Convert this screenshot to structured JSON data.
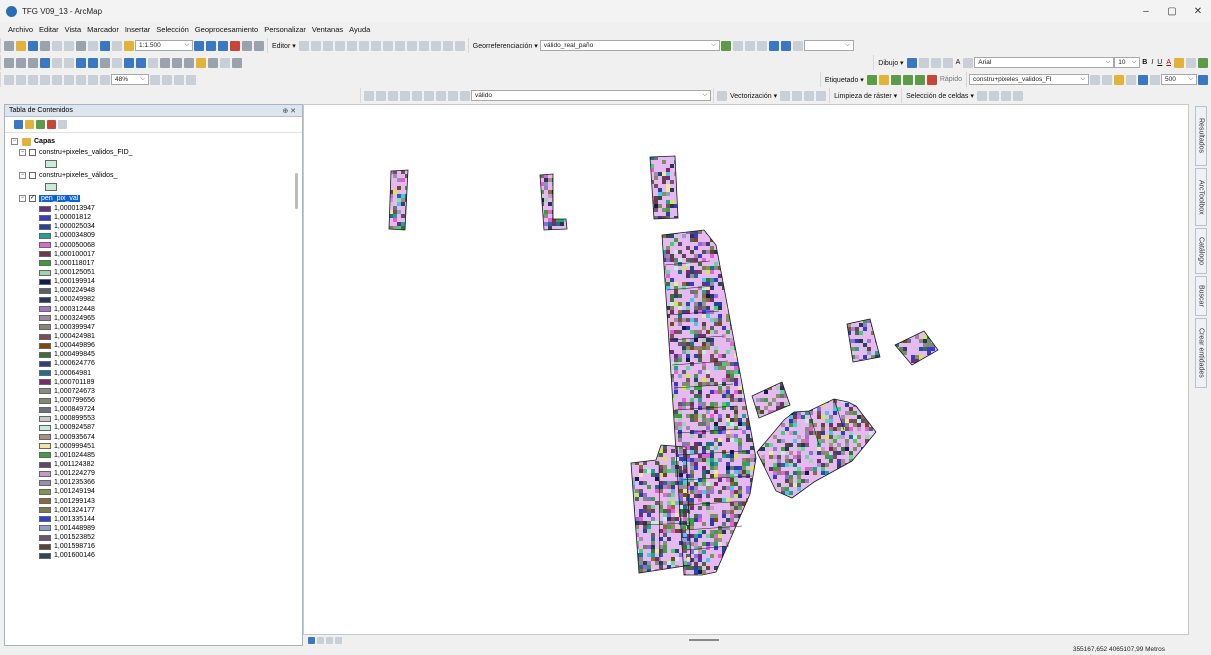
{
  "window": {
    "title": "TFG V09_13 - ArcMap",
    "minimize": "–",
    "maximize": "▢",
    "close": "✕"
  },
  "menu": [
    "Archivo",
    "Editar",
    "Vista",
    "Marcador",
    "Insertar",
    "Selección",
    "Geoprocesamiento",
    "Personalizar",
    "Ventanas",
    "Ayuda"
  ],
  "toolbars": {
    "scale": "1:1.500",
    "editor": "Editor ▾",
    "georef": "Georreferenciación ▾",
    "georef_layer": "válido_real_paño",
    "dibujo": "Dibujo ▾",
    "font": "Arial",
    "font_size": "10",
    "bold": "B",
    "italic": "I",
    "underline": "U",
    "font_color": "A",
    "etiquetado": "Etiquetado ▾",
    "rapido": "Rápido",
    "layer_select": "constru+pixeles_validos_FI",
    "zoom_value": "500",
    "zoom_pct": "48%",
    "valido_field": "válido",
    "vectorizacion": "Vectorización ▾",
    "limpieza": "Limpieza de ráster ▾",
    "seleccion_celdas": "Selección de celdas ▾"
  },
  "toc": {
    "title": "Tabla de Contenidos",
    "pin": "⊕ ✕",
    "root": "Capas",
    "layers": [
      {
        "name": "constru+pixeles_validos_FID_",
        "checked": false,
        "swatch": "#c8ecd9"
      },
      {
        "name": "constru+pixeles_válidos_",
        "checked": false,
        "swatch": "#c8ecd9"
      },
      {
        "name": "pen_pix_val",
        "checked": true
      }
    ],
    "legend": [
      {
        "label": "1,000013947",
        "color": "#6a2e7a"
      },
      {
        "label": "1,00001812",
        "color": "#3b3bbf"
      },
      {
        "label": "1,000025034",
        "color": "#2a3ea8"
      },
      {
        "label": "1,000034809",
        "color": "#1fa38c"
      },
      {
        "label": "1,000050068",
        "color": "#d66bd6"
      },
      {
        "label": "1,000100017",
        "color": "#6b3b4e"
      },
      {
        "label": "1,000118017",
        "color": "#3f9a3a"
      },
      {
        "label": "1,000125051",
        "color": "#9fd3b2"
      },
      {
        "label": "1,000199914",
        "color": "#141a4a"
      },
      {
        "label": "1,000224948",
        "color": "#5c5e66"
      },
      {
        "label": "1,000249982",
        "color": "#243a52"
      },
      {
        "label": "1,000312448",
        "color": "#9b79c6"
      },
      {
        "label": "1,000324965",
        "color": "#9c8aa0"
      },
      {
        "label": "1,000399947",
        "color": "#8d8378"
      },
      {
        "label": "1,000424981",
        "color": "#7a4e54"
      },
      {
        "label": "1,000449896",
        "color": "#7a4a14"
      },
      {
        "label": "1,000499845",
        "color": "#3c6f3c"
      },
      {
        "label": "1,000624776",
        "color": "#2c3f7a"
      },
      {
        "label": "1,00064981",
        "color": "#1e6f8c"
      },
      {
        "label": "1,000701189",
        "color": "#7a2a6a"
      },
      {
        "label": "1,000724673",
        "color": "#8a8a88"
      },
      {
        "label": "1,000799656",
        "color": "#7e8c68"
      },
      {
        "label": "1,000849724",
        "color": "#6e7078"
      },
      {
        "label": "1,000899553",
        "color": "#c9c9c9"
      },
      {
        "label": "1,000924587",
        "color": "#c7ebe3"
      },
      {
        "label": "1,000935674",
        "color": "#a19487"
      },
      {
        "label": "1,000999451",
        "color": "#efe6a6"
      },
      {
        "label": "1,001024485",
        "color": "#3fa041"
      },
      {
        "label": "1,001124382",
        "color": "#5e4a64"
      },
      {
        "label": "1,001224279",
        "color": "#c79ac4"
      },
      {
        "label": "1,001235366",
        "color": "#9a90aa"
      },
      {
        "label": "1,001249194",
        "color": "#7c9658"
      },
      {
        "label": "1,001299143",
        "color": "#8c6a3c"
      },
      {
        "label": "1,001324177",
        "color": "#7e7a52"
      },
      {
        "label": "1,001335144",
        "color": "#2d3fd6"
      },
      {
        "label": "1,001448989",
        "color": "#8ea0c4"
      },
      {
        "label": "1,001523852",
        "color": "#6b5a6c"
      },
      {
        "label": "1,001598716",
        "color": "#5a4638"
      },
      {
        "label": "1,001600146",
        "color": "#2a4a5c"
      }
    ]
  },
  "dock_tabs": [
    "Resultados",
    "ArcToolbox",
    "Catálogo",
    "Buscar",
    "Crear entidades"
  ],
  "status": {
    "coords": "355167,652  4065107,99 Metros"
  },
  "map": {
    "polygon_fill": "#e6baf0",
    "polygon_stroke": "#1a1a1a"
  }
}
